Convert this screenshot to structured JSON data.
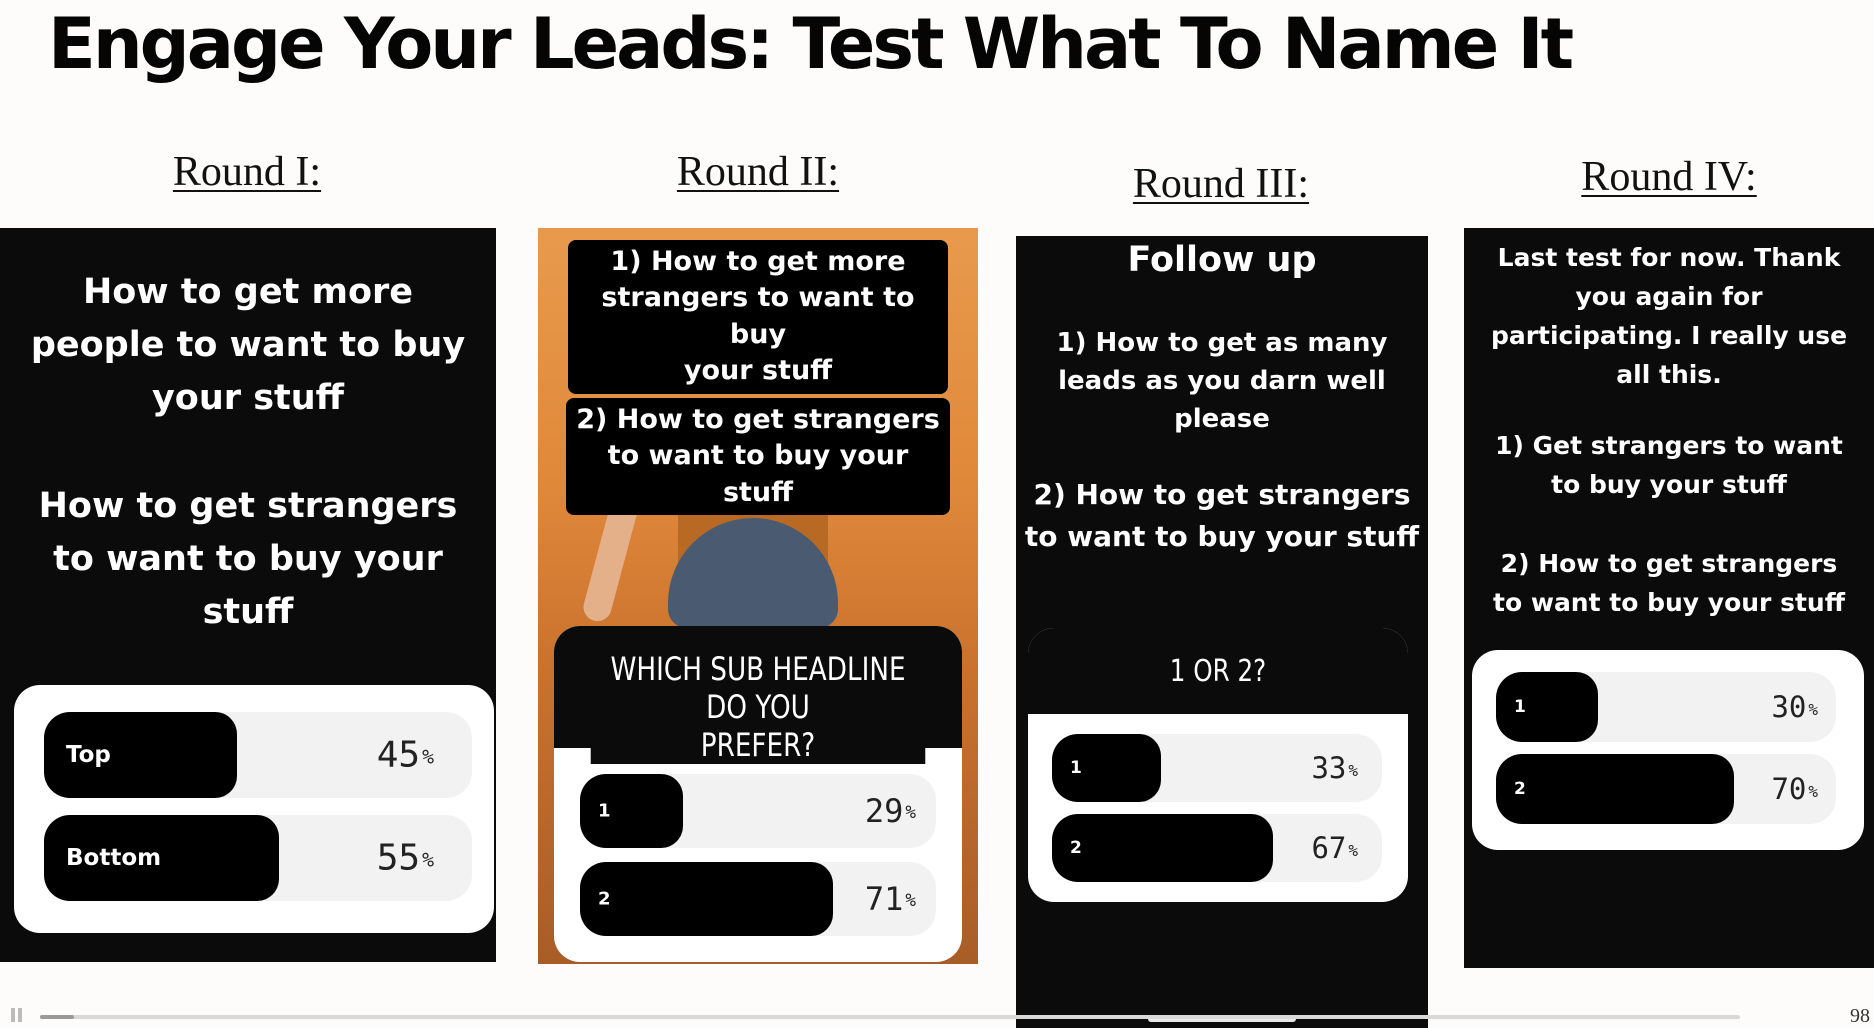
{
  "title": "Engage Your Leads: Test What To Name It",
  "rounds": [
    {
      "label": "Round I:",
      "text1": [
        "How to get more",
        "people to want to buy",
        "your stuff"
      ],
      "text2": [
        "How to get strangers",
        "to want to buy your",
        "stuff"
      ],
      "poll": [
        {
          "label": "Top",
          "percent": 45
        },
        {
          "label": "Bottom",
          "percent": 55
        }
      ]
    },
    {
      "label": "Round II:",
      "sticker1": [
        "1) How to get more",
        "strangers to want to buy",
        "your stuff"
      ],
      "sticker2": [
        "2) How to get strangers",
        "to want to buy your stuff"
      ],
      "question": [
        "WHICH SUB HEADLINE DO YOU",
        "PREFER?"
      ],
      "poll": [
        {
          "label": "1",
          "percent": 29
        },
        {
          "label": "2",
          "percent": 71
        }
      ]
    },
    {
      "label": "Round III:",
      "heading": "Follow up",
      "text1": [
        "1) How to get as many",
        "leads as you darn well",
        "please"
      ],
      "text2": [
        "2) How to get strangers",
        "to want to buy your stuff"
      ],
      "question": "1 OR 2?",
      "poll": [
        {
          "label": "1",
          "percent": 33
        },
        {
          "label": "2",
          "percent": 67
        }
      ]
    },
    {
      "label": "Round IV:",
      "text1": [
        "Last test for now. Thank",
        "you again for",
        "participating. I really use",
        "all this."
      ],
      "text2": [
        "1) Get strangers to want",
        "to buy your stuff"
      ],
      "text3": [
        "2) How to get strangers",
        "to want to buy your stuff"
      ],
      "poll": [
        {
          "label": "1",
          "percent": 30
        },
        {
          "label": "2",
          "percent": 70
        }
      ]
    }
  ],
  "percent_sign": "%",
  "page_number": "98",
  "playback_progress": 0.02,
  "colors": {
    "panel": "#0b0b0b",
    "bar_fill": "#000000",
    "bar_track": "#f2f2f2",
    "poll_card": "#ffffff"
  }
}
